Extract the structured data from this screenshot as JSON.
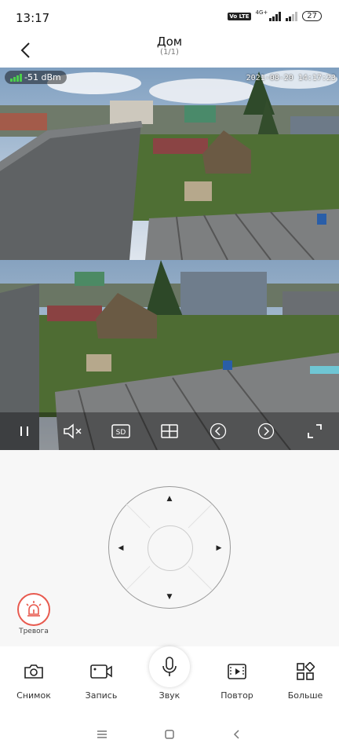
{
  "status_bar": {
    "time": "13:17",
    "volte": "Vo LTE",
    "network": "4G+",
    "battery": "27"
  },
  "header": {
    "title": "Дом",
    "subtitle": "(1/1)"
  },
  "video": {
    "signal": "-51 dBm",
    "timestamp": "2021-08-20 14:17:23",
    "quality": "SD"
  },
  "alarm": {
    "label": "Тревога",
    "accent": "#e85a4f"
  },
  "toolbar": {
    "snapshot": "Снимок",
    "record": "Запись",
    "sound": "Звук",
    "replay": "Повтор",
    "more": "Больше"
  },
  "icons": [
    "back-icon",
    "pause-icon",
    "mute-icon",
    "sd-icon",
    "split-icon",
    "prev-icon",
    "next-icon",
    "fullscreen-icon",
    "alarm-icon",
    "camera-icon",
    "video-camera-icon",
    "microphone-icon",
    "playback-icon",
    "more-icon"
  ]
}
